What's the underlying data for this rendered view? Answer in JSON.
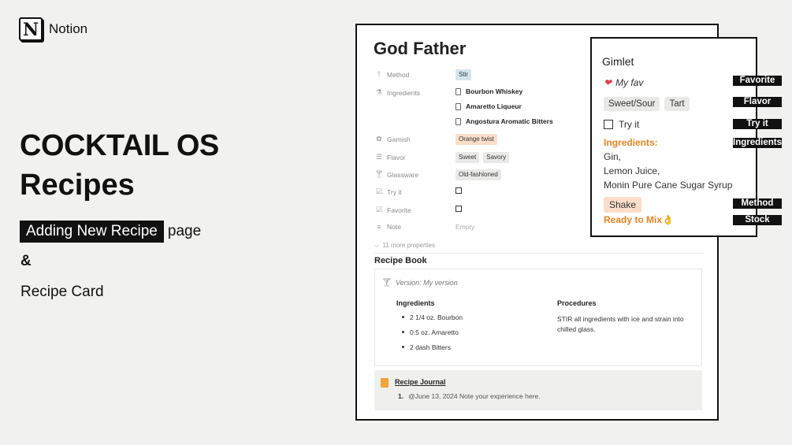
{
  "brand": {
    "name": "Notion",
    "logo_letter": "N"
  },
  "hero": {
    "line1": "COCKTAIL OS",
    "line2": "Recipes",
    "highlight": "Adding New Recipe",
    "highlight_suffix": "page",
    "amp": "&",
    "recipe_card": "Recipe Card"
  },
  "page": {
    "title": "God Father",
    "properties": {
      "method": {
        "label": "Method",
        "value": "Stir"
      },
      "ingredients": {
        "label": "Ingredients",
        "items": [
          "Bourbon Whiskey",
          "Amaretto Liqueur",
          "Angostura Aromatic Bitters"
        ]
      },
      "garnish": {
        "label": "Garnish",
        "value": "Orange twist"
      },
      "flavor": {
        "label": "Flavor",
        "tags": [
          "Sweet",
          "Savory"
        ]
      },
      "glassware": {
        "label": "Glassware",
        "value": "Old-fashioned"
      },
      "try_it": {
        "label": "Try it"
      },
      "favorite": {
        "label": "Favorite"
      },
      "note": {
        "label": "Note",
        "value": "Empty"
      }
    },
    "more_properties": "11 more properties",
    "recipe_book": {
      "title": "Recipe Book",
      "version": "Version: My version",
      "ingredients_header": "Ingredients",
      "ingredients": [
        "2 1/4 oz. Bourbon",
        "0.5 oz. Amaretto",
        "2 dash Bitters"
      ],
      "procedures_header": "Procedures",
      "procedures": "STIR all ingredients with ice and strain into chilled glass."
    },
    "journal": {
      "title": "Recipe Journal",
      "number": "1.",
      "entry": "@June 13, 2024 Note your experience here."
    }
  },
  "card": {
    "title": "Gimlet",
    "favorite": "My fav",
    "flavors": [
      "Sweet/Sour",
      "Tart"
    ],
    "try_it": "Try it",
    "ingredients_header": "Ingredients:",
    "ingredients": [
      "Gin,",
      "Lemon Juice,",
      "Monin Pure Cane Sugar Syrup"
    ],
    "method": "Shake",
    "stock": "Ready to Mix👌"
  },
  "labels": {
    "favorite": "Favorite",
    "flavor": "Flavor",
    "try_it": "Try it",
    "ingredients": "Ingredients",
    "method": "Method",
    "stock": "Stock"
  },
  "colors": {
    "accent_orange": "#e8831f",
    "heart": "#e03e4a",
    "tag_blue": "#d3e5ef",
    "tag_orange": "#fadec9",
    "tag_gray": "#e9e9e7"
  }
}
